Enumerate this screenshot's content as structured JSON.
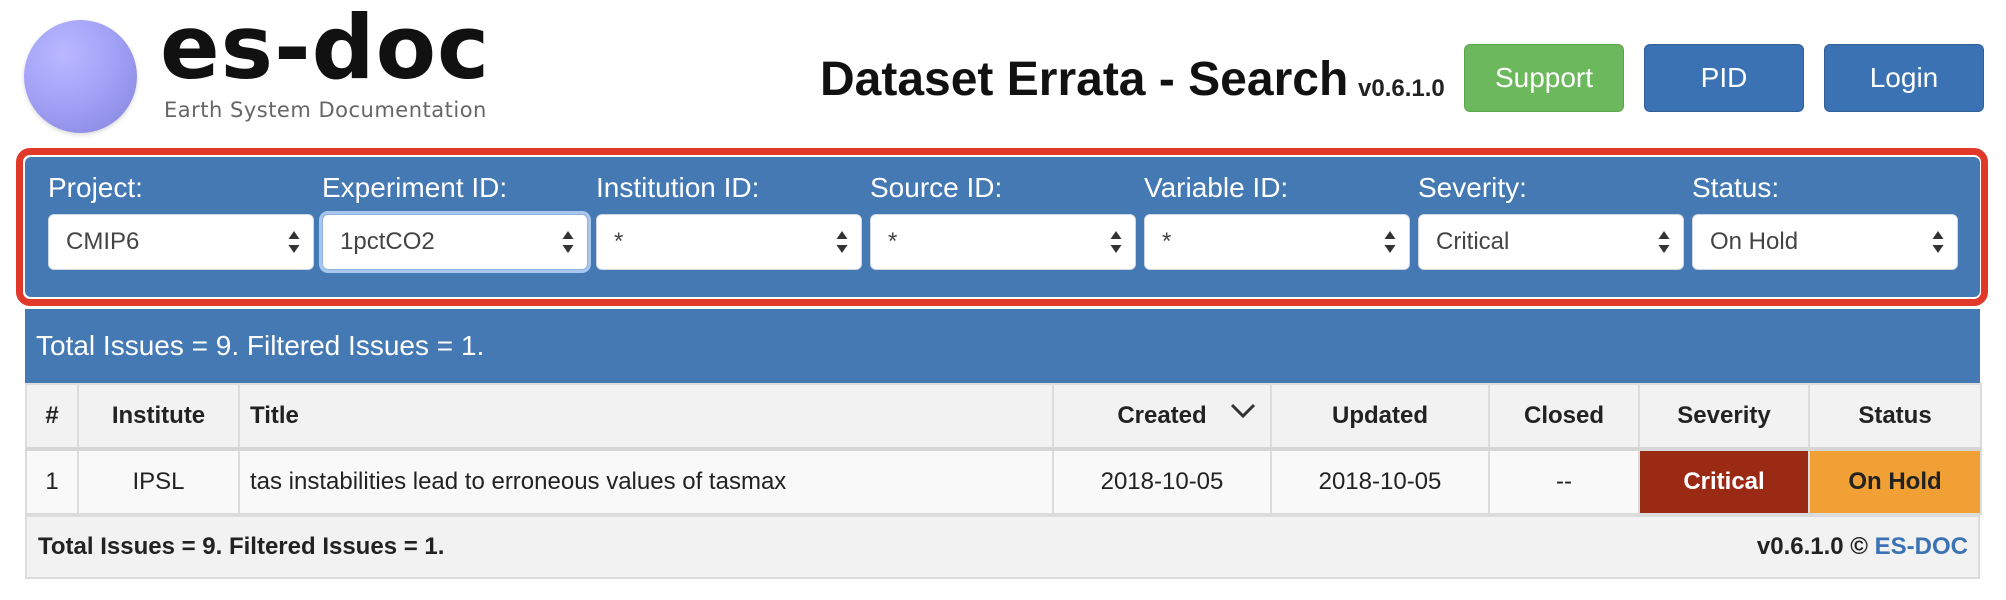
{
  "header": {
    "logo_word": "es-doc",
    "logo_subtitle": "Earth System Documentation",
    "title": "Dataset Errata - Search",
    "version": "v0.6.1.0",
    "buttons": {
      "support": "Support",
      "pid": "PID",
      "login": "Login"
    }
  },
  "filters": [
    {
      "label": "Project:",
      "value": "CMIP6"
    },
    {
      "label": "Experiment ID:",
      "value": "1pctCO2"
    },
    {
      "label": "Institution ID:",
      "value": "*"
    },
    {
      "label": "Source ID:",
      "value": "*"
    },
    {
      "label": "Variable ID:",
      "value": "*"
    },
    {
      "label": "Severity:",
      "value": "Critical"
    },
    {
      "label": "Status:",
      "value": "On Hold"
    }
  ],
  "summary": "Total Issues = 9. Filtered Issues = 1.",
  "table": {
    "columns": [
      "#",
      "Institute",
      "Title",
      "Created",
      "Updated",
      "Closed",
      "Severity",
      "Status"
    ],
    "rows": [
      [
        "1",
        "IPSL",
        "tas instabilities lead to erroneous values of tasmax",
        "2018-10-05",
        "2018-10-05",
        "--",
        "Critical",
        "On Hold"
      ]
    ]
  },
  "footer": {
    "summary": "Total Issues = 9. Filtered Issues = 1.",
    "version_prefix": "v0.6.1.0 ©",
    "link": "ES-DOC"
  },
  "colors": {
    "panel_blue": "#4479b3",
    "support_green": "#6cb85c",
    "button_blue": "#3b72b3",
    "highlight_red": "#e0392a",
    "severity_critical": "#9b2a15",
    "status_on_hold": "#f0a035"
  }
}
